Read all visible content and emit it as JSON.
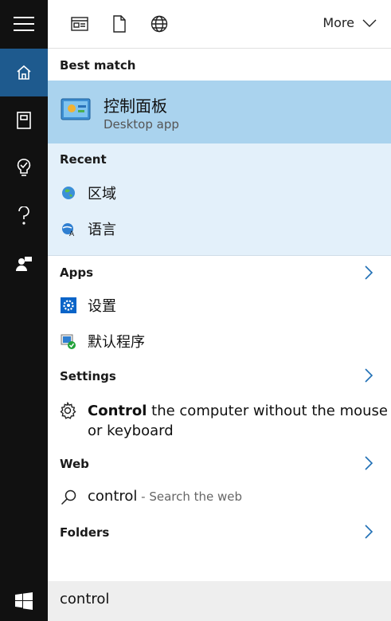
{
  "topbar": {
    "more_label": "More"
  },
  "best_match": {
    "heading": "Best match",
    "title": "控制面板",
    "subtitle": "Desktop app"
  },
  "recent": {
    "heading": "Recent",
    "items": [
      {
        "label": "区域",
        "icon": "globe-region-icon"
      },
      {
        "label": "语言",
        "icon": "language-icon"
      }
    ]
  },
  "apps": {
    "heading": "Apps",
    "items": [
      {
        "label": "设置",
        "icon": "settings-gear-icon"
      },
      {
        "label": "默认程序",
        "icon": "default-programs-icon"
      }
    ]
  },
  "settings": {
    "heading": "Settings",
    "bold": "Control",
    "rest_line1": " the computer without the mouse",
    "line2": "or keyboard"
  },
  "web": {
    "heading": "Web",
    "query": "control",
    "suffix": " - Search the web"
  },
  "folders": {
    "heading": "Folders"
  },
  "search": {
    "value": "control"
  },
  "colors": {
    "rail_bg": "#111111",
    "active_rail": "#1e5a8e",
    "best_match_bg": "#aad3ee",
    "recent_bg": "#e3f0fa",
    "accent_chevron": "#1f6fb5"
  }
}
